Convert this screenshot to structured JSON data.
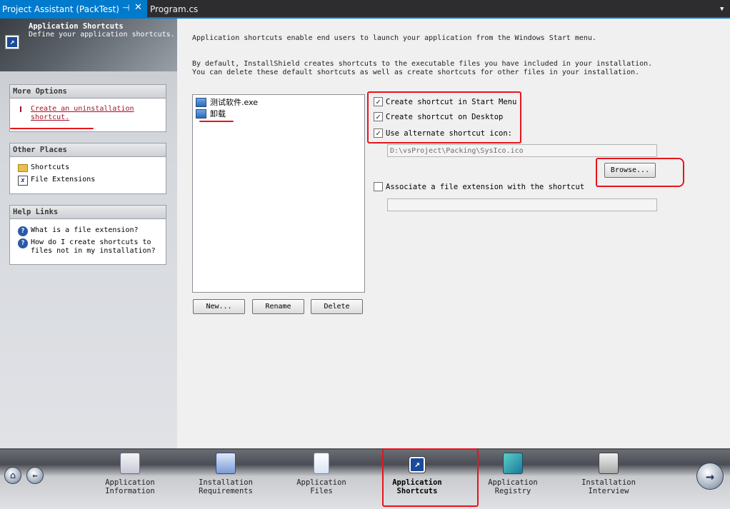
{
  "tabs": {
    "active": "Project Assistant (PackTest)",
    "pin_icon": "⊣",
    "close_icon": "✕",
    "inactive": "Program.cs",
    "dropdown": "▼"
  },
  "header": {
    "title": "Application Shortcuts",
    "subtitle": "Define your application shortcuts."
  },
  "more_options": {
    "title": "More Options",
    "link_line1": "Create an uninstallation",
    "link_line2": "shortcut."
  },
  "other_places": {
    "title": "Other Places",
    "items": [
      "Shortcuts",
      "File Extensions"
    ]
  },
  "help_links": {
    "title": "Help Links",
    "item1": "What is a file extension?",
    "item2_line1": "How do I create shortcuts to",
    "item2_line2": "files not in my installation?"
  },
  "main": {
    "desc1": "Application shortcuts enable end users to launch your application from the Windows Start menu.",
    "desc2_line1": "By default, InstallShield creates shortcuts to the executable files you have included in your installation.",
    "desc2_line2": "You can delete these default shortcuts as well as create shortcuts for other files in your installation.",
    "shortcuts": [
      "测试软件.exe",
      "卸载"
    ],
    "buttons": {
      "new": "New...",
      "rename": "Rename",
      "delete": "Delete",
      "browse": "Browse..."
    },
    "options": {
      "start_menu": "Create shortcut in Start Menu",
      "desktop": "Create shortcut on Desktop",
      "alt_icon": "Use alternate shortcut icon:",
      "icon_path": "D:\\vsProject\\Packing\\SysIco.ico",
      "assoc": "Associate a file extension with the shortcut",
      "assoc_value": ""
    },
    "checked": {
      "start_menu": true,
      "desktop": true,
      "alt_icon": true,
      "assoc": false
    }
  },
  "nav": {
    "items": [
      {
        "line1": "Application",
        "line2": "Information"
      },
      {
        "line1": "Installation",
        "line2": "Requirements"
      },
      {
        "line1": "Application",
        "line2": "Files"
      },
      {
        "line1": "Application",
        "line2": "Shortcuts"
      },
      {
        "line1": "Application",
        "line2": "Registry"
      },
      {
        "line1": "Installation",
        "line2": "Interview"
      }
    ],
    "home_icon": "⌂",
    "back_icon": "←",
    "next_icon": "→"
  },
  "colors": {
    "accent": "#007acc",
    "annotation": "#e8141e",
    "link": "#a0142a"
  }
}
